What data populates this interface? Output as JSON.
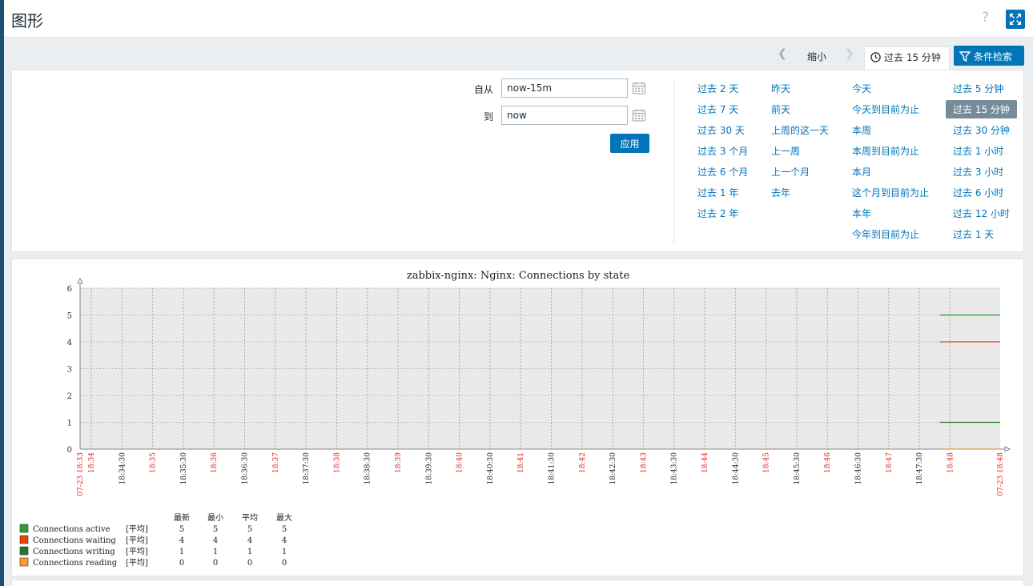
{
  "header": {
    "title": "图形",
    "help": "?"
  },
  "toolbar": {
    "zoom_out": "缩小",
    "time_tab": "过去 15 分钟",
    "filter": "条件检索"
  },
  "filter": {
    "from_label": "自从",
    "from_value": "now-15m",
    "to_label": "到",
    "to_value": "now",
    "apply": "应用",
    "columns": [
      [
        "过去 2 天",
        "过去 7 天",
        "过去 30 天",
        "过去 3 个月",
        "过去 6 个月",
        "过去 1 年",
        "过去 2 年"
      ],
      [
        "昨天",
        "前天",
        "上周的这一天",
        "上一周",
        "上一个月",
        "去年"
      ],
      [
        "今天",
        "今天到目前为止",
        "本周",
        "本周到目前为止",
        "本月",
        "这个月到目前为止",
        "本年",
        "今年到目前为止"
      ],
      [
        "过去 5 分钟",
        "过去 15 分钟",
        "过去 30 分钟",
        "过去 1 小时",
        "过去 3 小时",
        "过去 6 小时",
        "过去 12 小时",
        "过去 1 天"
      ]
    ],
    "selected": "过去 15 分钟"
  },
  "chart_data": {
    "type": "line",
    "title": "zabbix-nginx: Nginx: Connections by state",
    "ylim": [
      0,
      6
    ],
    "yticks": [
      0,
      1,
      2,
      3,
      4,
      5,
      6
    ],
    "x_ticks": [
      {
        "label": "07-23 18:33",
        "major": true
      },
      {
        "label": "18:34",
        "major": true
      },
      {
        "label": "18:34:30",
        "major": false
      },
      {
        "label": "18:35",
        "major": true
      },
      {
        "label": "18:35:30",
        "major": false
      },
      {
        "label": "18:36",
        "major": true
      },
      {
        "label": "18:36:30",
        "major": false
      },
      {
        "label": "18:37",
        "major": true
      },
      {
        "label": "18:37:30",
        "major": false
      },
      {
        "label": "18:38",
        "major": true
      },
      {
        "label": "18:38:30",
        "major": false
      },
      {
        "label": "18:39",
        "major": true
      },
      {
        "label": "18:39:30",
        "major": false
      },
      {
        "label": "18:40",
        "major": true
      },
      {
        "label": "18:40:30",
        "major": false
      },
      {
        "label": "18:41",
        "major": true
      },
      {
        "label": "18:41:30",
        "major": false
      },
      {
        "label": "18:42",
        "major": true
      },
      {
        "label": "18:42:30",
        "major": false
      },
      {
        "label": "18:43",
        "major": true
      },
      {
        "label": "18:43:30",
        "major": false
      },
      {
        "label": "18:44",
        "major": true
      },
      {
        "label": "18:44:30",
        "major": false
      },
      {
        "label": "18:45",
        "major": true
      },
      {
        "label": "18:45:30",
        "major": false
      },
      {
        "label": "18:46",
        "major": true
      },
      {
        "label": "18:46:30",
        "major": false
      },
      {
        "label": "18:47",
        "major": true
      },
      {
        "label": "18:47:30",
        "major": false
      },
      {
        "label": "18:48",
        "major": true
      },
      {
        "label": "07-23 18:48",
        "major": true
      }
    ],
    "series": [
      {
        "name": "Connections active",
        "color": "#1a9e1a",
        "values": [
          5
        ],
        "x_start": "18:47:50",
        "x_end": "18:48:20",
        "legend_color": "#2fa02f",
        "func": "[平均]",
        "last": 5,
        "min": 5,
        "avg": 5,
        "max": 5
      },
      {
        "name": "Connections waiting",
        "color": "#dd4422",
        "values": [
          4
        ],
        "x_start": "18:47:50",
        "x_end": "18:48:20",
        "legend_color": "#ee4400",
        "func": "[平均]",
        "last": 4,
        "min": 4,
        "avg": 4,
        "max": 4
      },
      {
        "name": "Connections writing",
        "color": "#1a7a1a",
        "values": [
          1
        ],
        "x_start": "18:47:50",
        "x_end": "18:48:20",
        "legend_color": "#227722",
        "func": "[平均]",
        "last": 1,
        "min": 1,
        "avg": 1,
        "max": 1
      },
      {
        "name": "Connections reading",
        "color": "#ee9933",
        "values": [
          0
        ],
        "x_start": "18:47:50",
        "x_end": "18:48:20",
        "legend_color": "#ff9933",
        "func": "[平均]",
        "last": 0,
        "min": 0,
        "avg": 0,
        "max": 0
      }
    ],
    "legend_headers": [
      "最新",
      "最小",
      "平均",
      "最大"
    ],
    "grid": true
  }
}
